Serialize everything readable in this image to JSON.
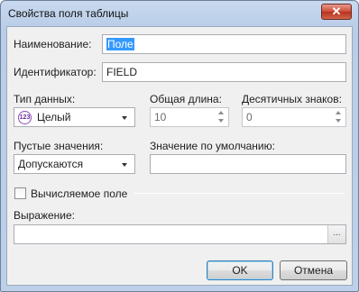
{
  "window": {
    "title": "Свойства поля таблицы",
    "close_glyph": "✕"
  },
  "form": {
    "name": {
      "label": "Наименование:",
      "value": "Поле"
    },
    "identifier": {
      "label": "Идентификатор:",
      "value": "FIELD"
    },
    "data_type": {
      "label": "Тип данных:",
      "value": "Целый",
      "icon": "integer-type-icon",
      "icon_text": "123"
    },
    "total_length": {
      "label": "Общая длина:",
      "value": "10"
    },
    "decimal_places": {
      "label": "Десятичных знаков:",
      "value": "0"
    },
    "empty_values": {
      "label": "Пустые значения:",
      "value": "Допускаются"
    },
    "default_value": {
      "label": "Значение по умолчанию:",
      "value": ""
    },
    "computed": {
      "label": "Вычисляемое поле",
      "checked": false
    },
    "expression": {
      "label": "Выражение:",
      "value": "",
      "browse_label": "..."
    }
  },
  "buttons": {
    "ok": "OK",
    "cancel": "Отмена"
  }
}
